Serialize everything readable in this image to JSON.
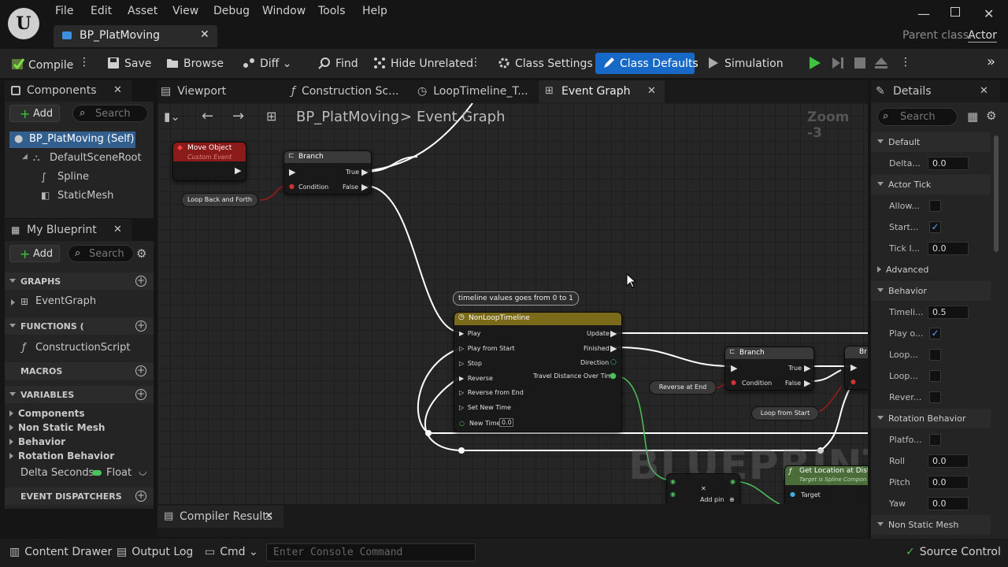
{
  "menu": [
    "File",
    "Edit",
    "Asset",
    "View",
    "Debug",
    "Window",
    "Tools",
    "Help"
  ],
  "doc_tab": "BP_PlatMoving",
  "parent_class_label": "Parent class:",
  "parent_class_value": "Actor",
  "toolbar": {
    "compile": "Compile",
    "save": "Save",
    "browse": "Browse",
    "diff": "Diff",
    "find": "Find",
    "hide_unrelated": "Hide Unrelated",
    "class_settings": "Class Settings",
    "class_defaults": "Class Defaults",
    "simulation": "Simulation"
  },
  "components": {
    "title": "Components",
    "add": "Add",
    "search": "Search",
    "items": [
      "BP_PlatMoving (Self)",
      "DefaultSceneRoot",
      "Spline",
      "StaticMesh"
    ]
  },
  "myblueprint": {
    "title": "My Blueprint",
    "add": "Add",
    "search": "Search",
    "graphs": "GRAPHS",
    "event_graph": "EventGraph",
    "functions": "FUNCTIONS (",
    "construction_script": "ConstructionScript",
    "macros": "MACROS",
    "variables": "VARIABLES",
    "var_groups": [
      "Components",
      "Non Static Mesh",
      "Behavior",
      "Rotation Behavior"
    ],
    "delta_seconds": "Delta Seconds",
    "delta_type": "Float",
    "event_dispatchers": "EVENT DISPATCHERS"
  },
  "graph_tabs": [
    "Viewport",
    "Construction Sc...",
    "LoopTimeline_T...",
    "Event Graph"
  ],
  "breadcrumb": {
    "root": "BP_PlatMoving",
    "sep": ">",
    "current": "Event Graph",
    "zoom": "Zoom -3"
  },
  "graph": {
    "move_object": {
      "title": "Move Object",
      "sub": "Custom Event"
    },
    "branch1": {
      "title": "Branch",
      "true": "True",
      "false": "False",
      "condition": "Condition"
    },
    "loop_back": "Loop Back and Forth",
    "comment": "timeline values goes from 0 to 1",
    "timeline": {
      "title": "NonLoopTimeline",
      "play": "Play",
      "play_from_start": "Play from Start",
      "stop": "Stop",
      "reverse": "Reverse",
      "reverse_from_end": "Reverse from End",
      "set_new_time": "Set New Time",
      "new_time": "New Time",
      "new_time_val": "0.0",
      "update": "Update",
      "finished": "Finished",
      "direction": "Direction",
      "travel": "Travel Distance Over Time"
    },
    "branch2": {
      "title": "Branch",
      "true": "True",
      "false": "False",
      "condition": "Condition"
    },
    "branch3_title": "Br",
    "reverse_at_end": "Reverse at End",
    "loop_from_start": "Loop from Start",
    "watermark": "BLUEPRINT",
    "add_pin": "Add pin",
    "get_location": {
      "title": "Get Location at Dista",
      "sub": "Target is Spline Compon",
      "target": "Target"
    }
  },
  "compiler_results": "Compiler Results",
  "details": {
    "title": "Details",
    "search": "Search",
    "sections": {
      "default": "Default",
      "actor_tick": "Actor Tick",
      "advanced": "Advanced",
      "behavior": "Behavior",
      "rotation_behavior": "Rotation Behavior",
      "non_static_mesh": "Non Static Mesh"
    },
    "delta": {
      "label": "Delta...",
      "value": "0.0"
    },
    "allow": {
      "label": "Allow..."
    },
    "start": {
      "label": "Start..."
    },
    "tick_interval": {
      "label": "Tick I...",
      "value": "0.0"
    },
    "timeline": {
      "label": "Timeli...",
      "value": "0.5"
    },
    "play_on": {
      "label": "Play o..."
    },
    "loop1": {
      "label": "Loop..."
    },
    "loop2": {
      "label": "Loop..."
    },
    "reverse": {
      "label": "Rever..."
    },
    "platform": {
      "label": "Platfo..."
    },
    "roll": {
      "label": "Roll",
      "value": "0.0"
    },
    "pitch": {
      "label": "Pitch",
      "value": "0.0"
    },
    "yaw": {
      "label": "Yaw",
      "value": "0.0"
    }
  },
  "statusbar": {
    "content_drawer": "Content Drawer",
    "output_log": "Output Log",
    "cmd": "Cmd",
    "console_placeholder": "Enter Console Command",
    "source_control": "Source Control"
  },
  "colors": {
    "accent": "#1769c7",
    "event": "#8b1a1a",
    "timeline": "#7a6a1a",
    "exec": "#ffffff",
    "bool": "#a31a1a",
    "float": "#4cc35a"
  }
}
